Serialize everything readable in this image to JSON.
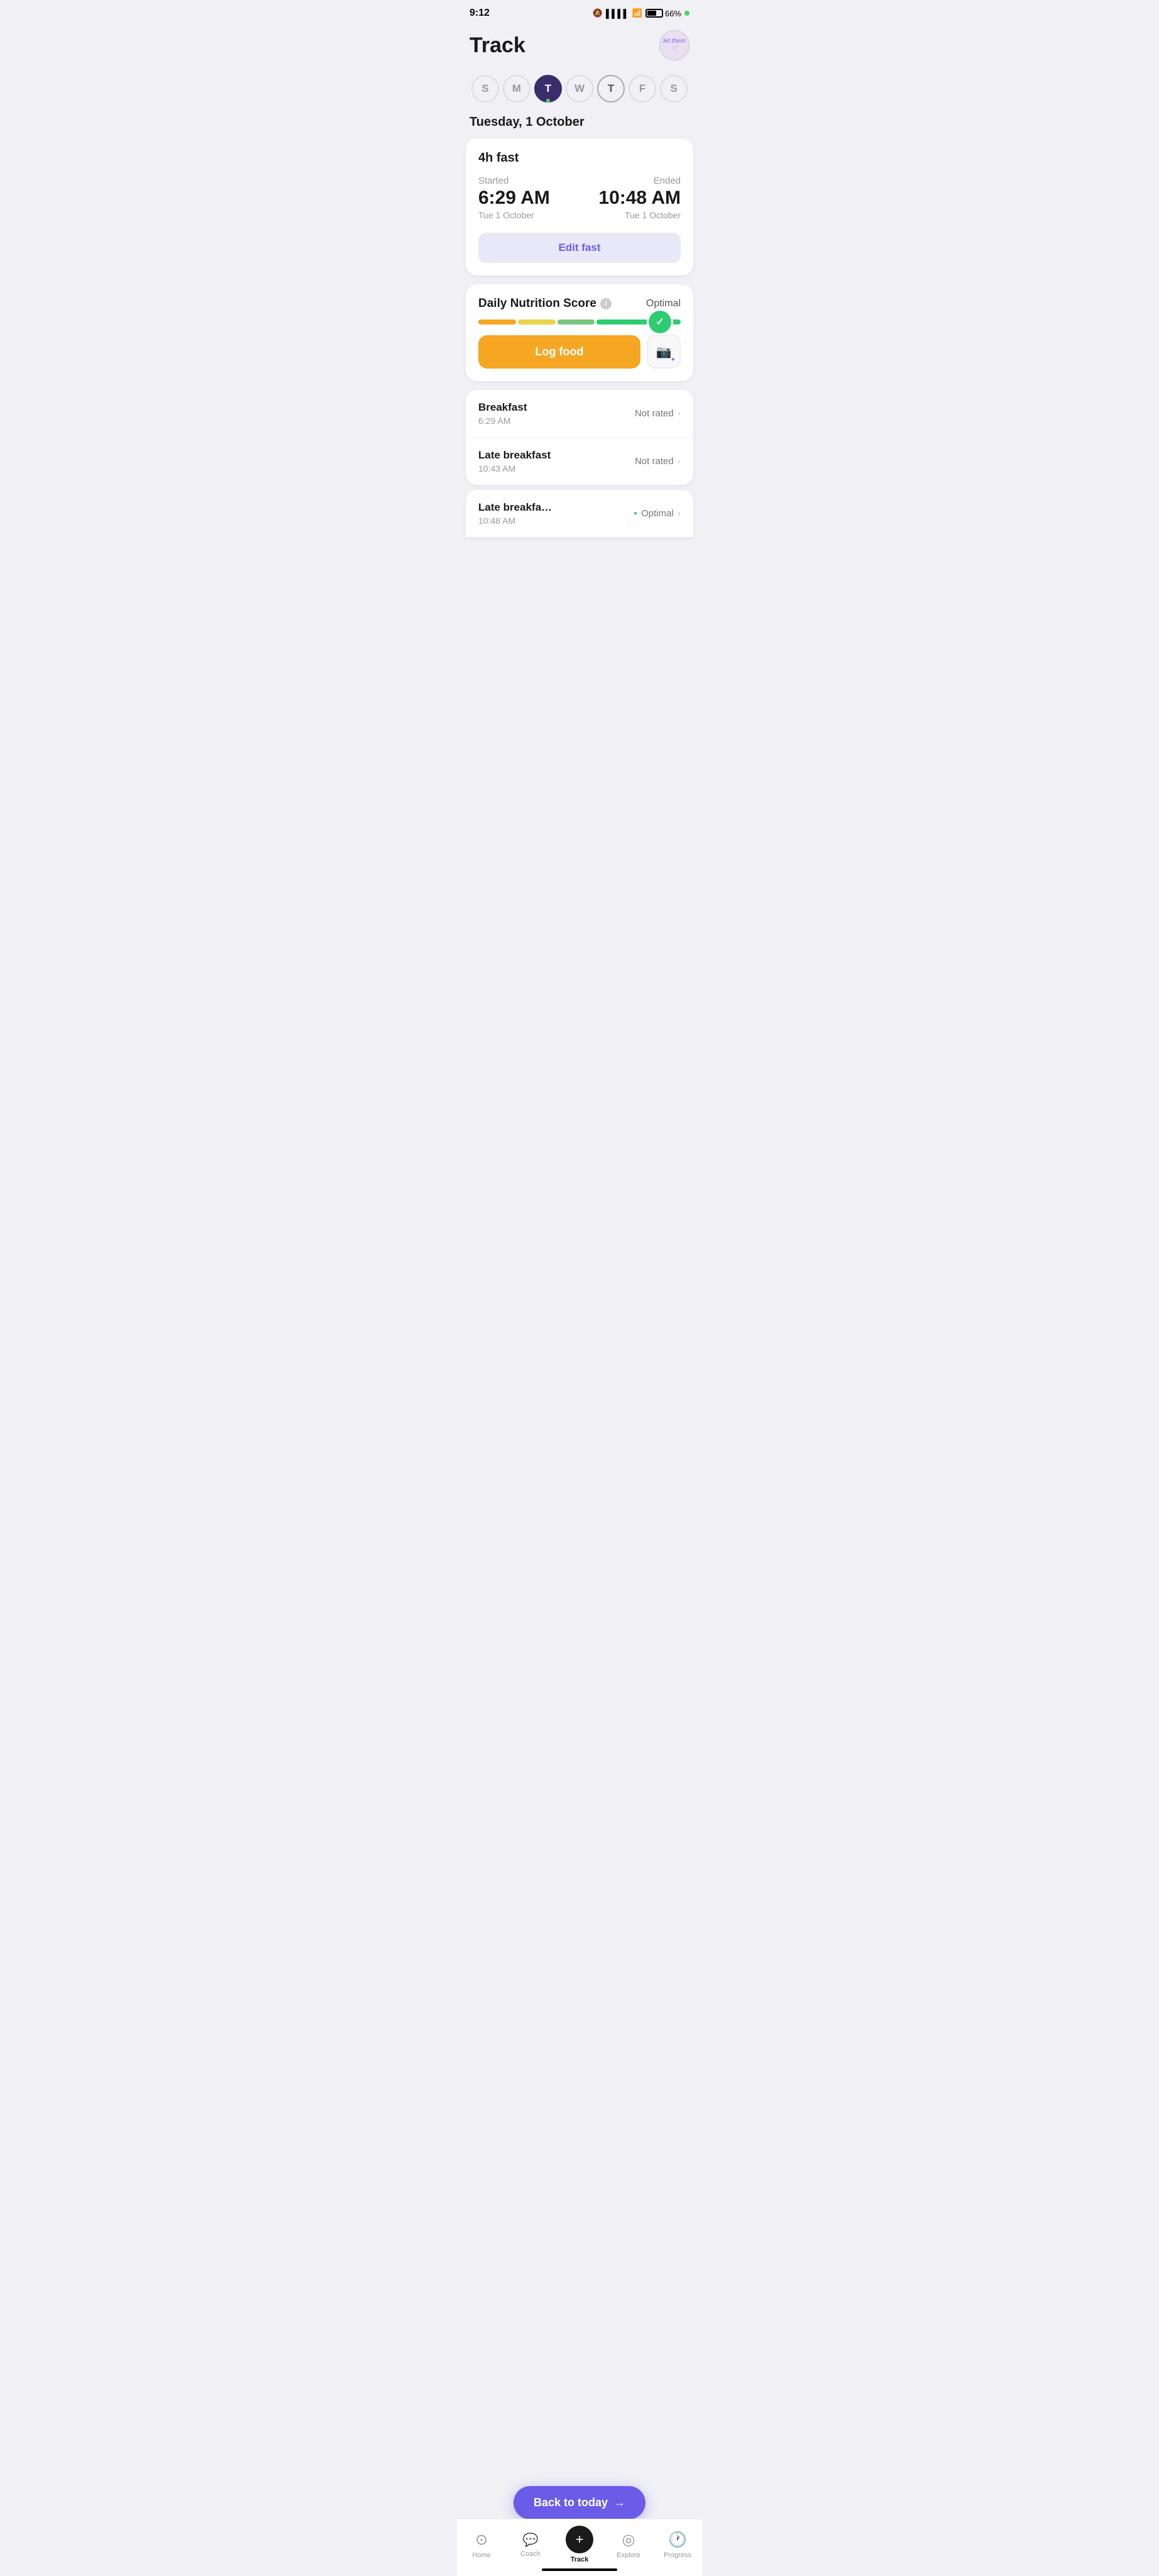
{
  "statusBar": {
    "time": "9:12",
    "battery": "66%"
  },
  "header": {
    "title": "Track",
    "avatarText": "let them\n♡"
  },
  "daySelector": {
    "days": [
      {
        "letter": "S",
        "active": false,
        "hasDot": false,
        "todayBorder": false
      },
      {
        "letter": "M",
        "active": false,
        "hasDot": false,
        "todayBorder": false
      },
      {
        "letter": "T",
        "active": true,
        "hasDot": true,
        "todayBorder": false
      },
      {
        "letter": "W",
        "active": false,
        "hasDot": false,
        "todayBorder": false
      },
      {
        "letter": "T",
        "active": false,
        "hasDot": false,
        "todayBorder": true
      },
      {
        "letter": "F",
        "active": false,
        "hasDot": false,
        "todayBorder": false
      },
      {
        "letter": "S",
        "active": false,
        "hasDot": false,
        "todayBorder": false
      }
    ],
    "currentDate": "Tuesday, 1 October"
  },
  "fastCard": {
    "title": "4h fast",
    "startedLabel": "Started",
    "endedLabel": "Ended",
    "startTime": "6:29 AM",
    "startDate": "Tue 1 October",
    "endTime": "10:48 AM",
    "endDate": "Tue 1 October",
    "editButton": "Edit fast"
  },
  "nutritionCard": {
    "title": "Daily Nutrition Score",
    "status": "Optimal",
    "logFoodButton": "Log food"
  },
  "meals": [
    {
      "name": "Breakfast",
      "time": "6:29 AM",
      "rating": "Not rated"
    },
    {
      "name": "Late breakfast",
      "time": "10:43 AM",
      "rating": "Not rated"
    },
    {
      "name": "Late breakfast",
      "time": "10:48 AM",
      "rating": "Optimal"
    }
  ],
  "backToToday": "Back to today",
  "bottomNav": {
    "items": [
      {
        "label": "Home",
        "icon": "⊙",
        "active": false
      },
      {
        "label": "Coach",
        "icon": "💬",
        "active": false
      },
      {
        "label": "Track",
        "icon": "+",
        "active": true
      },
      {
        "label": "Explore",
        "icon": "◎",
        "active": false
      },
      {
        "label": "Progress",
        "icon": "🕐",
        "active": false
      }
    ]
  }
}
